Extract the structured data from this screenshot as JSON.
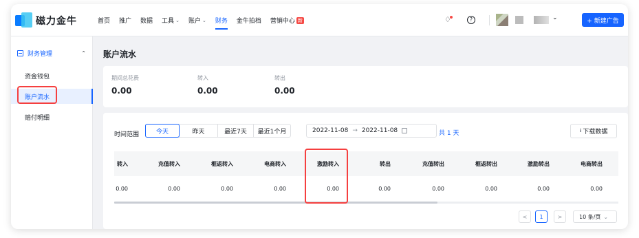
{
  "brand": {
    "name": "磁力金牛"
  },
  "nav": {
    "items": [
      {
        "label": "首页",
        "caret": false,
        "active": false
      },
      {
        "label": "推广",
        "caret": false,
        "active": false
      },
      {
        "label": "数据",
        "caret": false,
        "active": false
      },
      {
        "label": "工具",
        "caret": true,
        "active": false
      },
      {
        "label": "账户",
        "caret": true,
        "active": false
      },
      {
        "label": "财务",
        "caret": false,
        "active": true
      },
      {
        "label": "金牛拍档",
        "caret": false,
        "active": false
      },
      {
        "label": "营销中心",
        "caret": false,
        "active": false,
        "badge": "新"
      }
    ],
    "new_ad_button": "+ 新建广告"
  },
  "sidebar": {
    "group": "财务管理",
    "items": [
      {
        "label": "资金钱包"
      },
      {
        "label": "账户流水"
      },
      {
        "label": "赔付明细"
      }
    ]
  },
  "page": {
    "title": "账户流水"
  },
  "summary": [
    {
      "label": "期间总花费",
      "value": "0.00"
    },
    {
      "label": "转入",
      "value": "0.00"
    },
    {
      "label": "转出",
      "value": "0.00"
    }
  ],
  "filter": {
    "label": "时间范围",
    "options": [
      "今天",
      "昨天",
      "最近7天",
      "最近1个月"
    ],
    "active_option": "今天",
    "range_start": "2022-11-08",
    "range_sep": "→",
    "range_end": "2022-11-08",
    "range_count": "共 1 天",
    "download_button": "下载数据"
  },
  "table": {
    "headers": [
      "转入",
      "充值转入",
      "框返转入",
      "电商转入",
      "激励转入",
      "转出",
      "充值转出",
      "框返转出",
      "激励转出",
      "电商转出"
    ],
    "rows": [
      [
        "0.00",
        "0.00",
        "0.00",
        "0.00",
        "0.00",
        "0.00",
        "0.00",
        "0.00",
        "0.00",
        "0.00"
      ]
    ]
  },
  "pagination": {
    "prev": "<",
    "current_page": "1",
    "next": ">",
    "page_size": "10 条/页"
  },
  "colors": {
    "accent": "#1664ff",
    "highlight": "#f53f3f",
    "badge": "#f54a45"
  }
}
